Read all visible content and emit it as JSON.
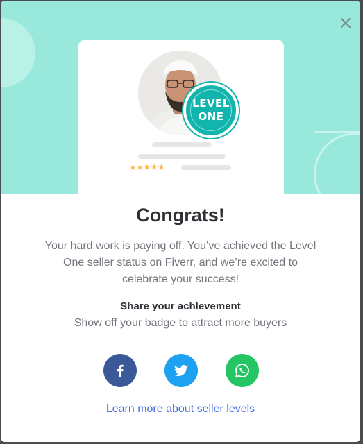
{
  "badge": {
    "line1": "LEVEL",
    "line2": "ONE"
  },
  "rating": {
    "stars": "★★★★★"
  },
  "congrats": {
    "title": "Congrats!",
    "message": "Your hard work is paying off. You’ve achieved the Level One seller status on Fiverr, and we’re excited to celebrate your success!"
  },
  "share": {
    "title": "Share your achlevement",
    "subtitle": "Show off your badge to attract more buyers"
  },
  "social_buttons": [
    {
      "icon": "facebook-icon",
      "color": "#3b5999"
    },
    {
      "icon": "twitter-icon",
      "color": "#1da1f2"
    },
    {
      "icon": "whatsapp-icon",
      "color": "#25c464"
    }
  ],
  "footer": {
    "link_label": "Learn more about seller levels"
  },
  "colors": {
    "hero_bg": "#98e9dc",
    "badge": "#11b5ad",
    "link": "#446ee7",
    "star": "#ffb33e"
  }
}
